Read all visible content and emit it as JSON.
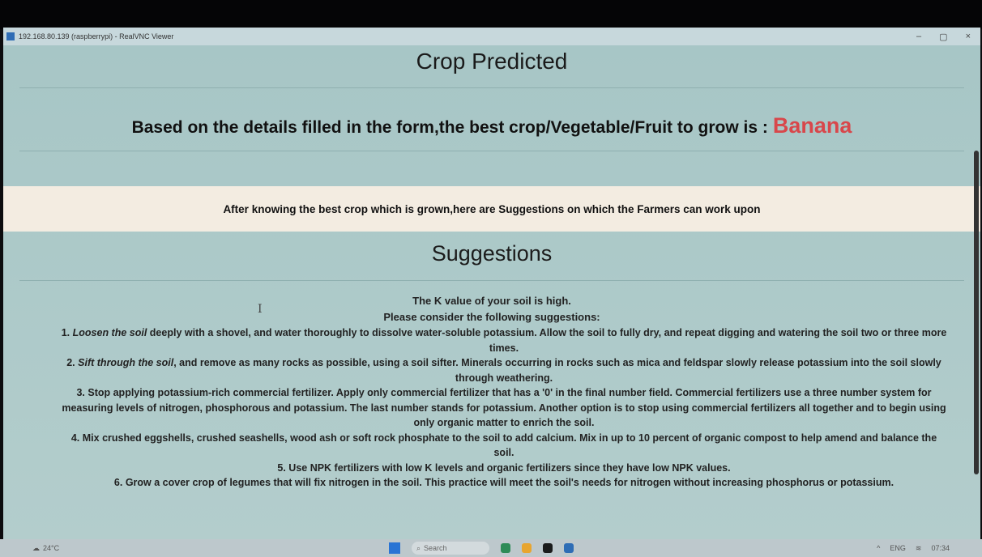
{
  "window": {
    "title": "192.168.80.139 (raspberrypi) - RealVNC Viewer",
    "controls": [
      "–",
      "▢",
      "×"
    ]
  },
  "page": {
    "heading": "Crop Predicted",
    "result_text": "Based on the details filled in the form,the best crop/Vegetable/Fruit to grow is :",
    "crop": "Banana",
    "banner": "After knowing the best crop which is grown,here are Suggestions on which the Farmers can work upon",
    "suggestions_title": "Suggestions",
    "intro_line1": "The K value of your soil is high.",
    "intro_line2": "Please consider the following suggestions:",
    "items": [
      {
        "num": "1.",
        "em": "Loosen the soil",
        "text": " deeply with a shovel, and water thoroughly to dissolve water-soluble potassium. Allow the soil to fully dry, and repeat digging and watering the soil two or three more times."
      },
      {
        "num": "2.",
        "em": "Sift through the soil",
        "text": ", and remove as many rocks as possible, using a soil sifter. Minerals occurring in rocks such as mica and feldspar slowly release potassium into the soil slowly through weathering."
      },
      {
        "num": "3.",
        "em": "",
        "text": " Stop applying potassium-rich commercial fertilizer. Apply only commercial fertilizer that has a '0' in the final number field. Commercial fertilizers use a three number system for measuring levels of nitrogen, phosphorous and potassium. The last number stands for potassium. Another option is to stop using commercial fertilizers all together and to begin using only organic matter to enrich the soil."
      },
      {
        "num": "4.",
        "em": "",
        "text": " Mix crushed eggshells, crushed seashells, wood ash or soft rock phosphate to the soil to add calcium. Mix in up to 10 percent of organic compost to help amend and balance the soil."
      },
      {
        "num": "5.",
        "em": "",
        "text": " Use NPK fertilizers with low K levels and organic fertilizers since they have low NPK values."
      },
      {
        "num": "6.",
        "em": "",
        "text": " Grow a cover crop of legumes that will fix nitrogen in the soil. This practice will meet the soil's needs for nitrogen without increasing phosphorus or potassium."
      }
    ]
  },
  "taskbar": {
    "weather_temp": "24°C",
    "search_placeholder": "Search",
    "tray_lang": "ENG",
    "clock": "07:34"
  },
  "colors": {
    "crop": "#d8474b",
    "banner_bg": "#f3ece1",
    "page_bg": "#a9c7c6"
  }
}
